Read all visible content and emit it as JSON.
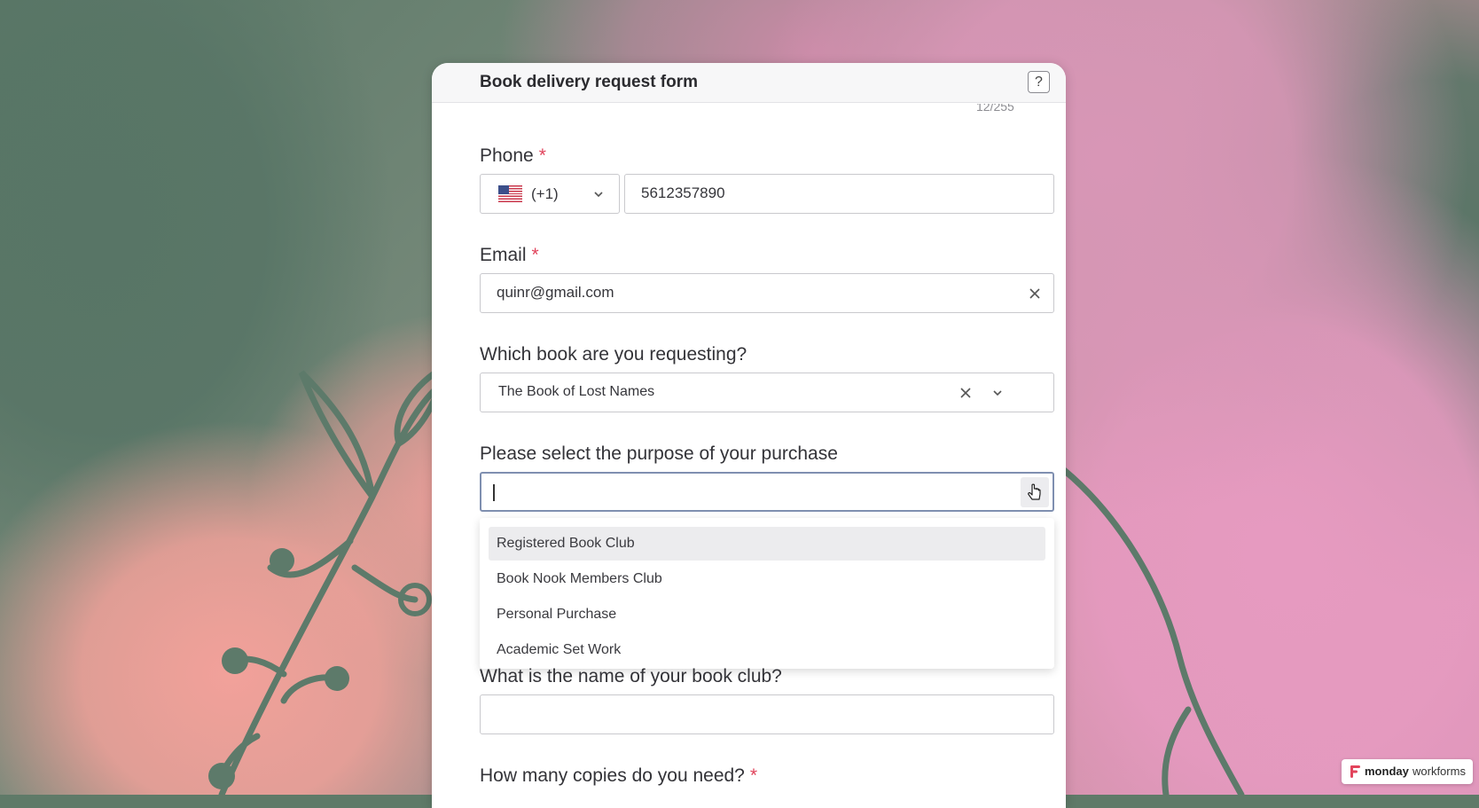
{
  "form": {
    "title": "Book delivery request form",
    "help_label": "?",
    "char_counter": "12/255"
  },
  "required_mark": "*",
  "phone": {
    "label": "Phone",
    "country_flag": "us-flag-icon",
    "dial_code": "(+1)",
    "value": "5612357890"
  },
  "email": {
    "label": "Email",
    "value": "quinr@gmail.com"
  },
  "book": {
    "label": "Which book are you requesting?",
    "value": "The Book of Lost Names"
  },
  "purpose": {
    "label": "Please select the purpose of your purchase",
    "value": "",
    "options": [
      "Registered Book Club",
      "Book Nook Members Club",
      "Personal Purchase",
      "Academic Set Work"
    ],
    "highlighted_option": "Registered Book Club"
  },
  "book_club": {
    "label": "What is the name of your book club?",
    "value": ""
  },
  "copies": {
    "label": "How many copies do you need?"
  },
  "badge": {
    "brand": "monday",
    "product": "workforms"
  },
  "colors": {
    "required": "#e0435b",
    "focus_border": "#7f8fb0",
    "decoration": "#5d7a6a",
    "brand_logo": "#e2445c"
  }
}
